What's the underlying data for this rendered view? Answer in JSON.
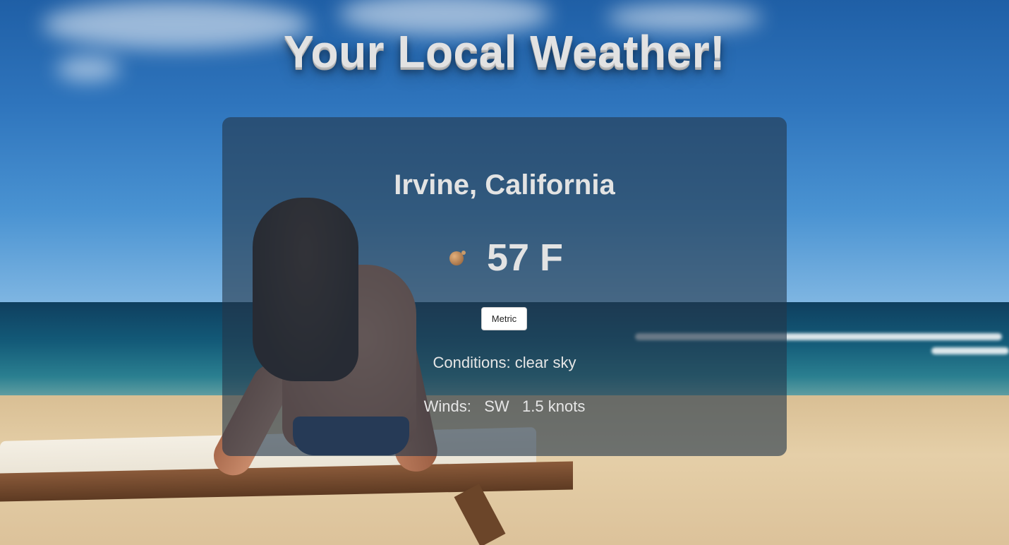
{
  "header": {
    "title": "Your Local Weather!"
  },
  "weather": {
    "location": "Irvine, California",
    "temperature": "57 F",
    "unit_toggle_label": "Metric",
    "conditions_label": "Conditions:",
    "conditions_value": "clear sky",
    "winds_label": "Winds:",
    "wind_direction": "SW",
    "wind_speed": "1.5 knots",
    "icon": "clear-sky-icon"
  },
  "background": {
    "scene": "beach-photo"
  },
  "colors": {
    "card_overlay": "#23374b",
    "text": "#e3e3e3",
    "button_bg": "#ffffff"
  }
}
